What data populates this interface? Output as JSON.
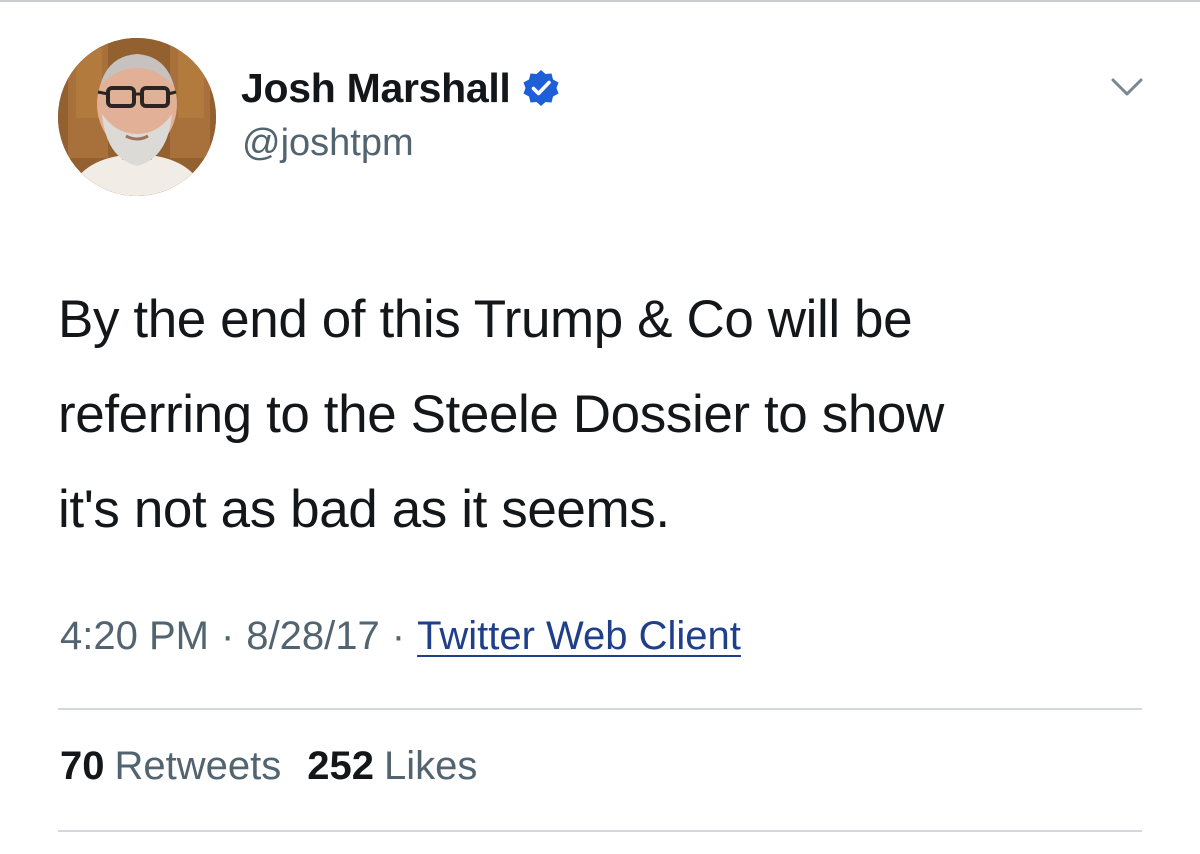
{
  "tweet": {
    "author": {
      "display_name": "Josh Marshall",
      "handle": "@joshtpm",
      "verified": true,
      "avatar_icon": "profile-photo"
    },
    "menu_icon": "chevron-down-icon",
    "text": "By the end of this Trump & Co will be\nreferring to the Steele Dossier to show\nit's not as bad as it seems.",
    "meta": {
      "time": "4:20 PM",
      "date": "8/28/17",
      "separator": "·",
      "source": "Twitter Web Client"
    },
    "stats": {
      "retweets_count": "70",
      "retweets_label": "Retweets",
      "likes_count": "252",
      "likes_label": "Likes"
    }
  },
  "colors": {
    "text_primary": "#14171a",
    "text_secondary": "#536471",
    "link": "#1f3f8a",
    "verified_blue": "#1d5fd6",
    "divider": "#d5d8db"
  }
}
